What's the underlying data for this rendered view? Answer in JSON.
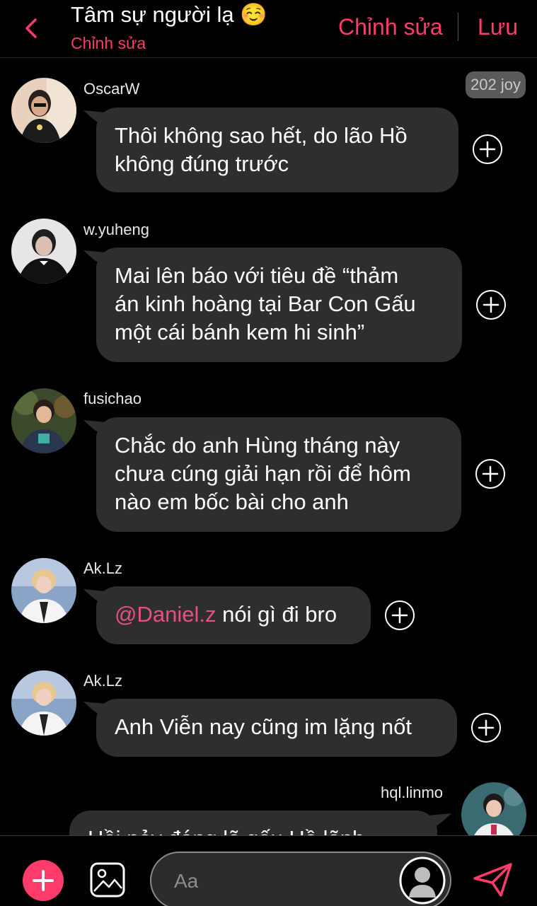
{
  "header": {
    "title": "Tâm sự người lạ ☺️",
    "subtitle": "Chỉnh sửa",
    "edit_label": "Chỉnh sửa",
    "save_label": "Lưu"
  },
  "joy_badge": "202 joy",
  "messages": [
    {
      "user": "OscarW",
      "lines": [
        "Thôi không sao hết, do lão Hồ",
        "không đúng trước"
      ]
    },
    {
      "user": "w.yuheng",
      "lines": [
        "Mai lên báo với tiêu đề “thảm",
        "án kinh hoàng tại Bar Con Gấu",
        "một cái bánh kem hi sinh”"
      ]
    },
    {
      "user": "fusichao",
      "lines": [
        "Chắc do anh Hùng tháng này",
        "chưa cúng giải hạn rồi để hôm",
        "nào em bốc bài cho anh"
      ]
    },
    {
      "user": "Ak.Lz",
      "mention": "@Daniel.z",
      "text": " nói gì đi bro"
    },
    {
      "user": "Ak.Lz",
      "lines": [
        "Anh Viễn nay cũng im lặng nốt"
      ]
    },
    {
      "user": "hql.linmo",
      "lines": [
        "Hồi nảy đáng lẽ gấu Hồ lãnh"
      ]
    }
  ],
  "composer": {
    "placeholder": "Aa"
  },
  "colors": {
    "accent": "#ff3b6b",
    "mention": "#e64f85",
    "bubble": "#2e2e2e",
    "background": "#000000"
  },
  "icons": [
    "chevron-left-icon",
    "plus-circle-icon",
    "image-icon",
    "person-icon",
    "send-icon"
  ]
}
